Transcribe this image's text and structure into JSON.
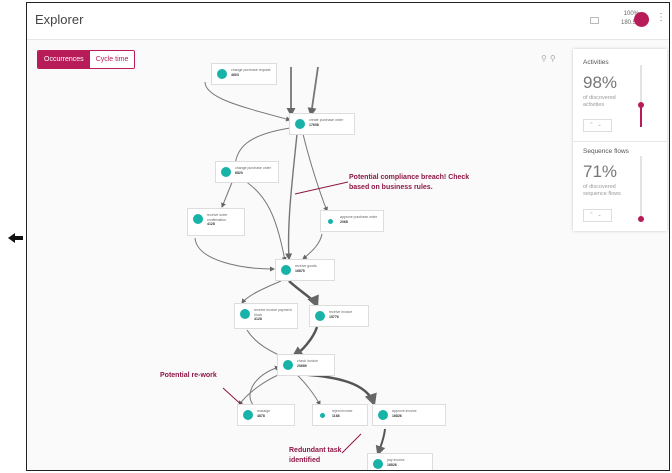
{
  "header": {
    "title": "Explorer",
    "zoom_primary": "100%",
    "zoom_secondary": "180.5k"
  },
  "toolbar": {
    "occurrences_label": "Occurrences",
    "cycle_time_label": "Cycle time"
  },
  "panel": {
    "activities": {
      "title": "Activities",
      "percent": "98%",
      "caption": "of discovered activities",
      "level": 0.98
    },
    "sequence_flows": {
      "title": "Sequence flows",
      "percent": "71%",
      "caption": "of discovered sequence flows",
      "level": 0.71
    }
  },
  "process_map": {
    "nodes": [
      {
        "label": "change purchase request",
        "value": "4603"
      },
      {
        "label": "create purchase order",
        "value": "17608"
      },
      {
        "label": "change purchase order",
        "value": "6820"
      },
      {
        "label": "receive order confirmation",
        "value": "4128"
      },
      {
        "label": "approve purchase order",
        "value": "2068"
      },
      {
        "label": "receive goods",
        "value": "16875"
      },
      {
        "label": "receive invoice payment block",
        "value": "4128"
      },
      {
        "label": "receive invoice",
        "value": "15776"
      },
      {
        "label": "check invoice",
        "value": "20689"
      },
      {
        "label": "reassign",
        "value": "4878"
      },
      {
        "label": "reject invoice",
        "value": "1168"
      },
      {
        "label": "approve invoice",
        "value": "16826"
      },
      {
        "label": "pay invoice",
        "value": "16826"
      }
    ],
    "annotations": {
      "compliance": "Potential compliance breach! Check based on business rules.",
      "rework": "Potential re-work",
      "redundant": "Redundant task identified"
    }
  },
  "colors": {
    "accent": "#b81c58",
    "node_dot": "#17b2a8",
    "annotation": "#8e1745"
  },
  "icons": {
    "zoom_in": "zoom-in-icon",
    "zoom_out": "zoom-out-icon",
    "more": "more-vertical-icon"
  }
}
